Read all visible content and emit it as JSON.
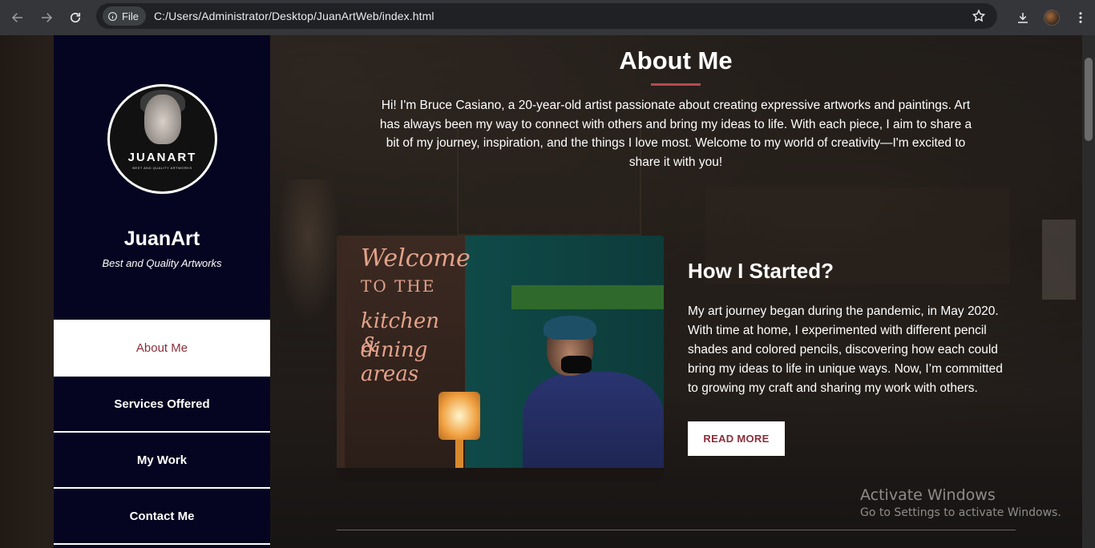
{
  "browser": {
    "chip_label": "File",
    "url": "C:/Users/Administrator/Desktop/JuanArtWeb/index.html"
  },
  "sidebar": {
    "logo_text": "JUANART",
    "logo_sub": "BEST AND QUALITY ARTWORKS",
    "brand": "JuanArt",
    "tagline": "Best and Quality Artworks",
    "items": [
      {
        "label": "About Me",
        "active": true
      },
      {
        "label": "Services Offered"
      },
      {
        "label": "My Work"
      },
      {
        "label": "Contact Me"
      }
    ]
  },
  "main": {
    "title": "About Me",
    "intro": "Hi! I'm Bruce Casiano, a 20-year-old artist passionate about creating expressive artworks and paintings. Art has always been my way to connect with others and bring my ideas to life. With each piece, I aim to share a bit of my journey, inspiration, and the things I love most. Welcome to my world of creativity—I'm excited to share it with you!",
    "photo_chalk": {
      "line1": "Welcome",
      "line2": "TO THE",
      "line3": "kitchen &",
      "line4": "dining areas"
    },
    "section_title": "How I Started?",
    "section_body": "My art journey began during the pandemic, in May 2020. With time at home, I experimented with different pencil shades and colored pencils, discovering how each could bring my ideas to life in unique ways. Now, I’m committed to growing my craft and sharing my work with others.",
    "read_more": "READ MORE"
  },
  "watermark": {
    "title": "Activate Windows",
    "subtitle": "Go to Settings to activate Windows."
  },
  "colors": {
    "sidebar_bg": "#050521",
    "accent": "#8a2f3a",
    "title_underline": "#b84a4f"
  }
}
